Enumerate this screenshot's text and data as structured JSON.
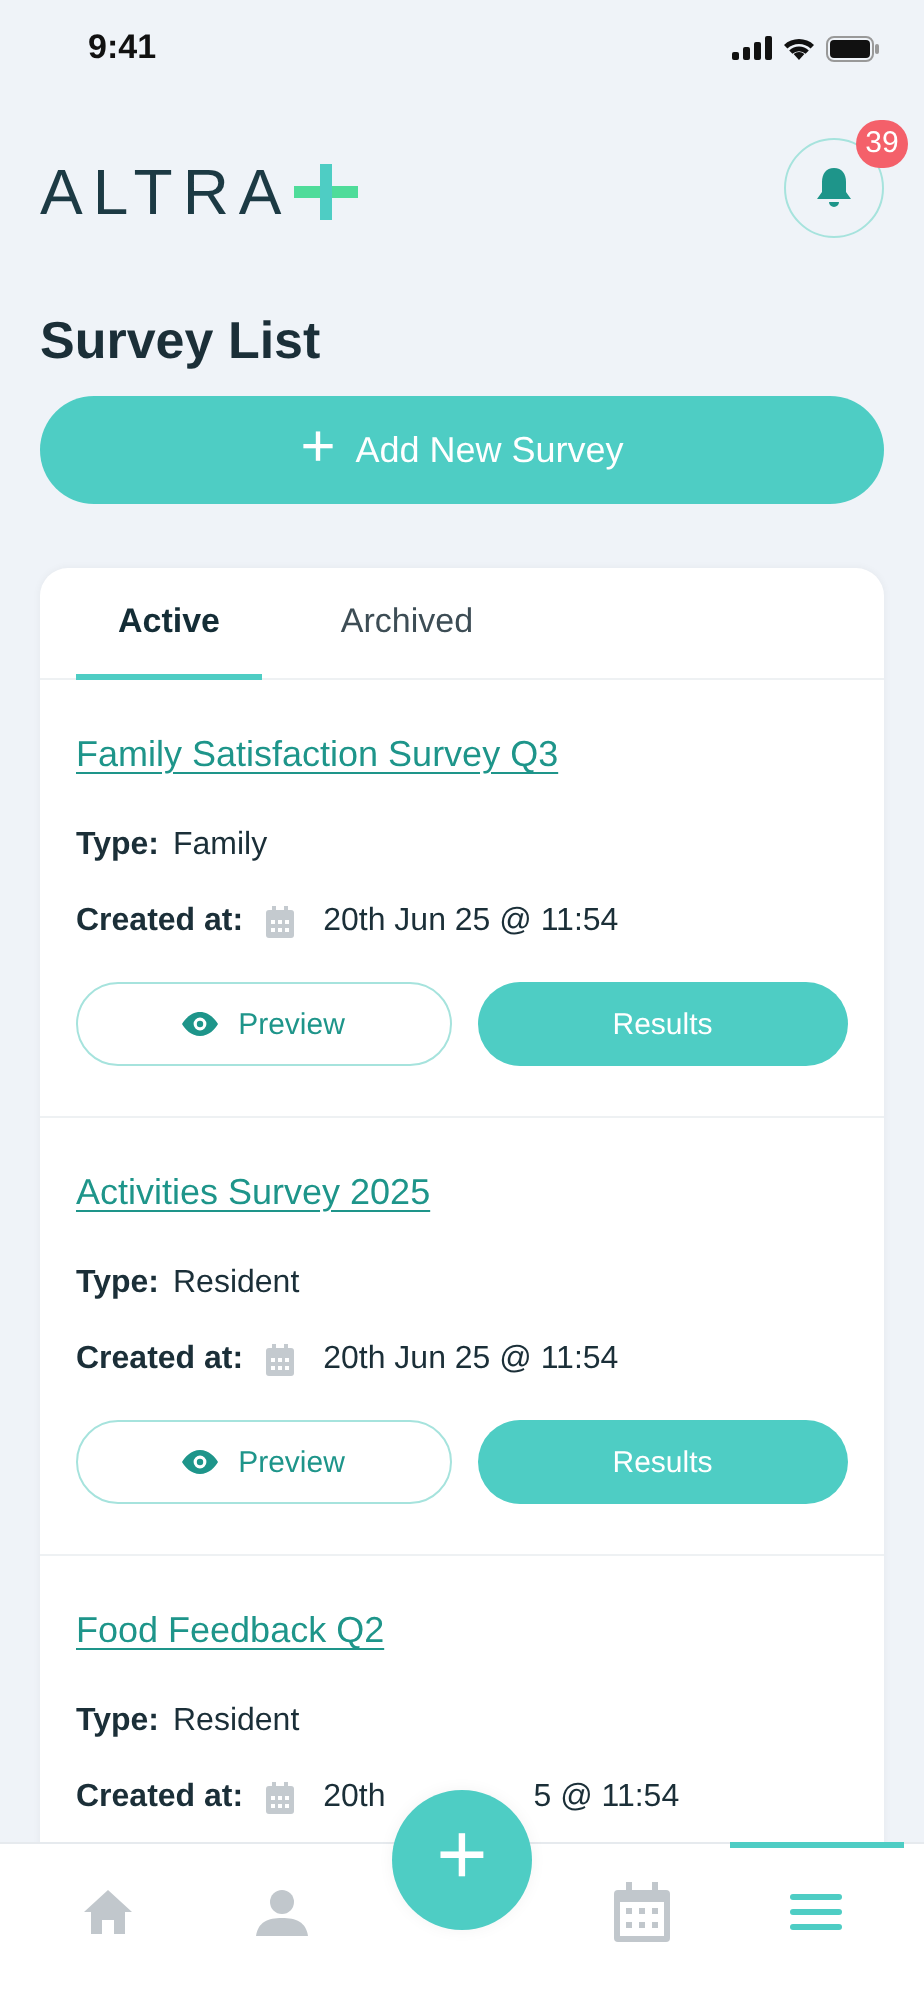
{
  "status_bar": {
    "time": "9:41"
  },
  "header": {
    "logo": "ALTRA",
    "notifications": {
      "count": "39"
    }
  },
  "title": "Survey List",
  "add_button": {
    "icon": "+",
    "label": "Add New Survey"
  },
  "tabs": [
    {
      "label": "Active",
      "selected": true
    },
    {
      "label": "Archived",
      "selected": false
    }
  ],
  "surveys": [
    {
      "title": "Family Satisfaction Survey Q3",
      "type_label": "Type:",
      "type": "Family",
      "created_label": "Created at:",
      "created": "20th Jun 25 @ 11:54",
      "buttons": {
        "preview": "Preview",
        "results": "Results"
      }
    },
    {
      "title": "Activities Survey 2025",
      "type_label": "Type:",
      "type": "Resident",
      "created_label": "Created at:",
      "created": "20th Jun 25 @ 11:54",
      "buttons": {
        "preview": "Preview",
        "results": "Results"
      }
    },
    {
      "title": "Food Feedback Q2",
      "type_label": "Type:",
      "type": "Resident",
      "created_label": "Created at:",
      "created": "20th",
      "created_after_fab": "5 @ 11:54"
    }
  ],
  "fab": {
    "icon": "+"
  },
  "nav": [
    {
      "kind": "home",
      "selected": false
    },
    {
      "kind": "profile",
      "selected": false
    },
    {
      "kind": "calendar",
      "selected": false
    },
    {
      "kind": "menu",
      "selected": true
    }
  ]
}
